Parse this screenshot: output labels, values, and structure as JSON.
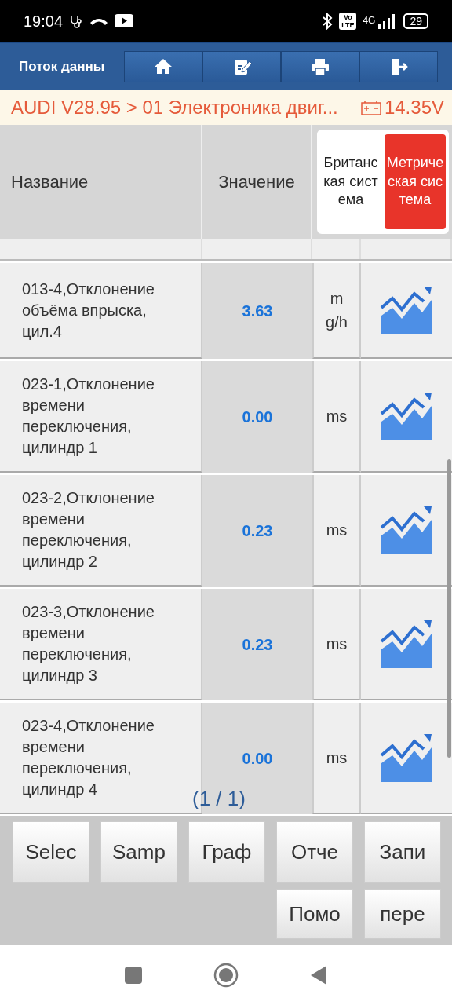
{
  "status_bar": {
    "time": "19:04",
    "network": "4G",
    "volte": "Vo LTE",
    "battery": "29"
  },
  "app_bar": {
    "title": "Поток данны",
    "tools": [
      {
        "kind": "home"
      },
      {
        "kind": "edit"
      },
      {
        "kind": "print"
      },
      {
        "kind": "exit"
      }
    ]
  },
  "breadcrumb": {
    "path": "AUDI V28.95 > 01 Электроника двиг...",
    "voltage": "14.35V"
  },
  "table": {
    "columns": [
      "Название",
      "Значение"
    ],
    "unit_toggle": [
      {
        "label": "Британская система",
        "selected": false
      },
      {
        "label": "Метрическая система",
        "selected": true
      }
    ],
    "rows": [
      {
        "name": "013-4,Отклонение объёма впрыска, цил.4",
        "value": "3.63",
        "unit": "mg/h"
      },
      {
        "name": "023-1,Отклонение времени переключения, цилиндр 1",
        "value": "0.00",
        "unit": "ms"
      },
      {
        "name": "023-2,Отклонение времени переключения, цилиндр 2",
        "value": "0.23",
        "unit": "ms"
      },
      {
        "name": "023-3,Отклонение времени переключения, цилиндр 3",
        "value": "0.23",
        "unit": "ms"
      },
      {
        "name": "023-4,Отклонение времени переключения, цилиндр 4",
        "value": "0.00",
        "unit": "ms"
      }
    ],
    "pagination": "(1 / 1)"
  },
  "buttons": [
    "Selec",
    "Samp",
    "Граф",
    "Отче",
    "Запи",
    "Помо",
    "пере"
  ]
}
